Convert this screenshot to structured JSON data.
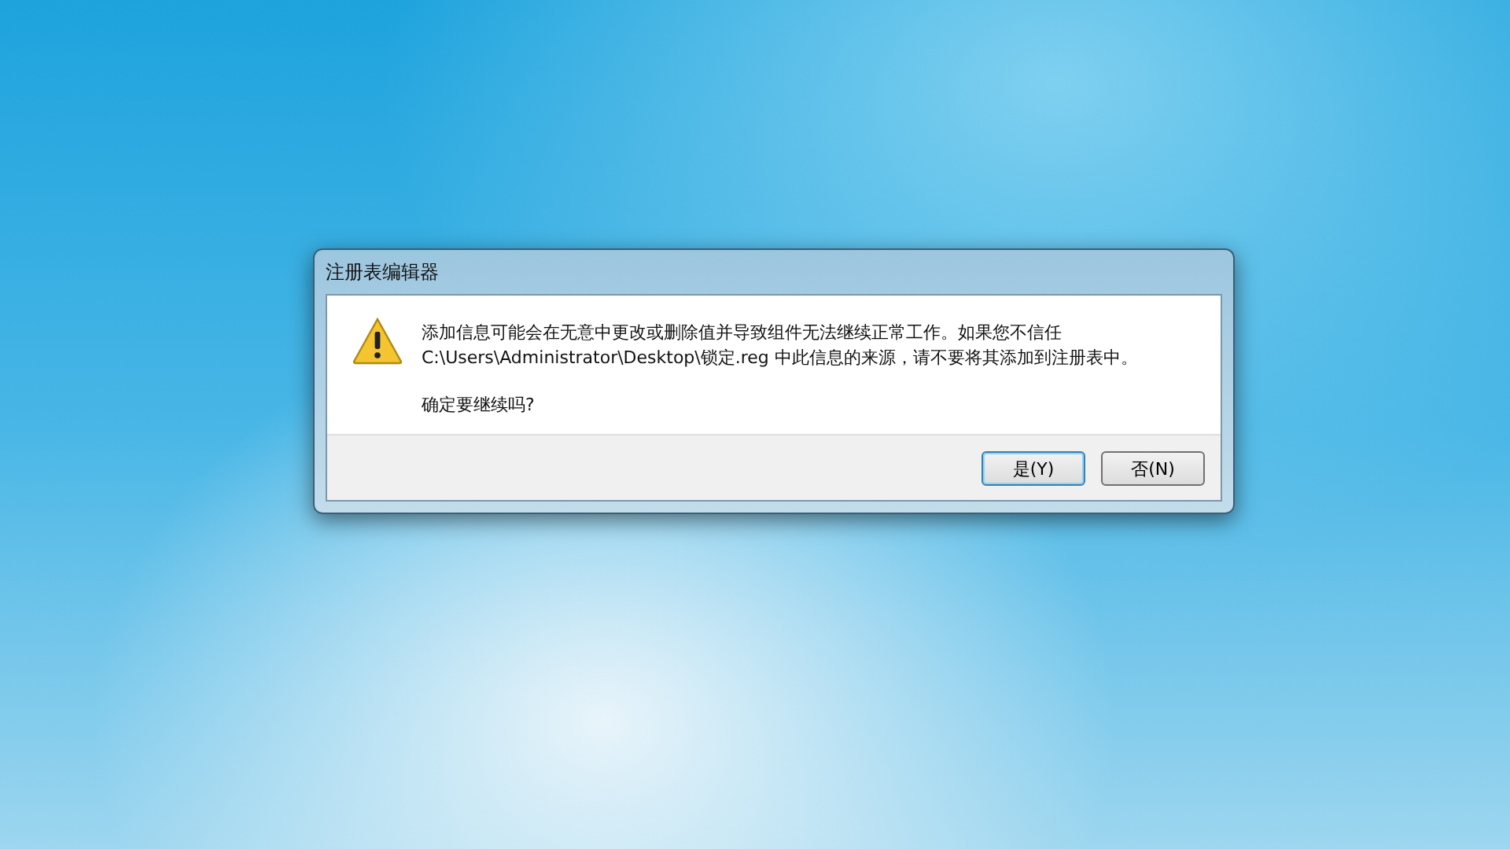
{
  "window": {
    "title": "注册表编辑器"
  },
  "message": "添加信息可能会在无意中更改或删除值并导致组件无法继续正常工作。如果您不信任 C:\\Users\\Administrator\\Desktop\\锁定.reg 中此信息的来源，请不要将其添加到注册表中。",
  "question": "确定要继续吗?",
  "buttons": [
    {
      "label": "是(Y)",
      "default": true
    },
    {
      "label": "否(N)",
      "default": false
    }
  ]
}
